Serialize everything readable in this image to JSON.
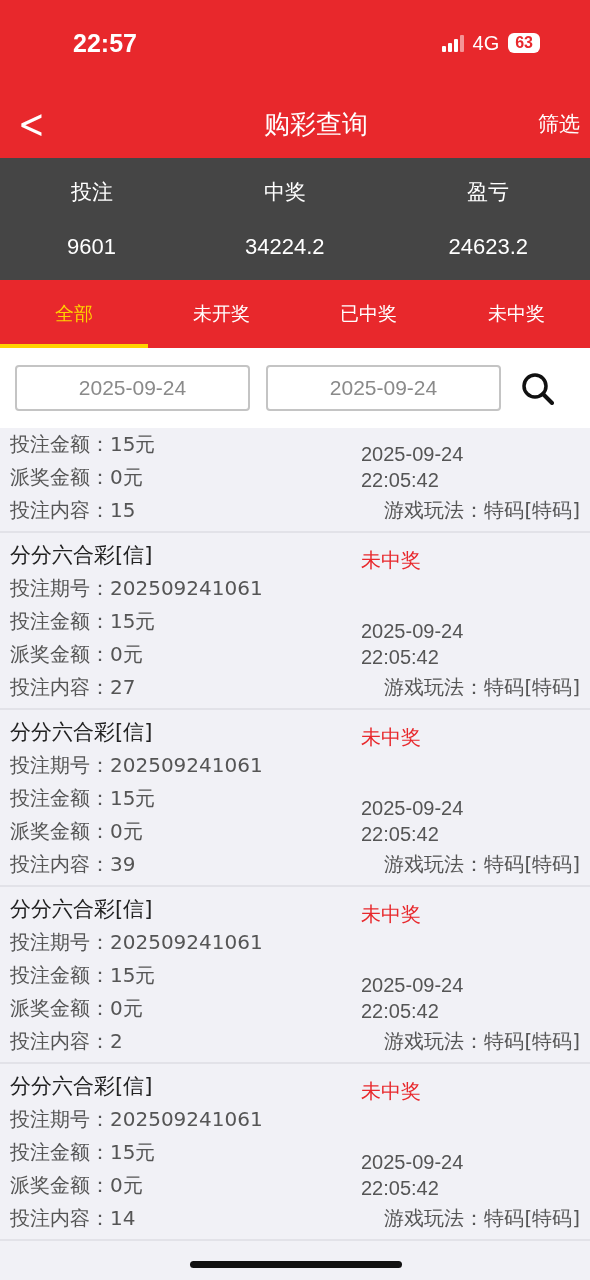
{
  "status_bar": {
    "time": "22:57",
    "network": "4G",
    "battery": "63"
  },
  "nav": {
    "back": "<",
    "title": "购彩查询",
    "action": "筛选"
  },
  "summary": [
    {
      "label": "投注",
      "value": "9601"
    },
    {
      "label": "中奖",
      "value": "34224.2"
    },
    {
      "label": "盈亏",
      "value": "24623.2"
    }
  ],
  "tabs": [
    {
      "label": "全部",
      "selected": true
    },
    {
      "label": "未开奖",
      "selected": false
    },
    {
      "label": "已中奖",
      "selected": false
    },
    {
      "label": "未中奖",
      "selected": false
    }
  ],
  "date_range": {
    "start": "2025-09-24",
    "end": "2025-09-24"
  },
  "records": [
    {
      "amount": "投注金额：15元",
      "payout": "派奖金额：0元",
      "content": "投注内容：15",
      "date": "2025-09-24",
      "time": "22:05:42",
      "play": "游戏玩法：特码[特码]"
    },
    {
      "name": "分分六合彩[信]",
      "status": "未中奖",
      "period": "投注期号：202509241061",
      "amount": "投注金额：15元",
      "payout": "派奖金额：0元",
      "content": "投注内容：27",
      "date": "2025-09-24",
      "time": "22:05:42",
      "play": "游戏玩法：特码[特码]"
    },
    {
      "name": "分分六合彩[信]",
      "status": "未中奖",
      "period": "投注期号：202509241061",
      "amount": "投注金额：15元",
      "payout": "派奖金额：0元",
      "content": "投注内容：39",
      "date": "2025-09-24",
      "time": "22:05:42",
      "play": "游戏玩法：特码[特码]"
    },
    {
      "name": "分分六合彩[信]",
      "status": "未中奖",
      "period": "投注期号：202509241061",
      "amount": "投注金额：15元",
      "payout": "派奖金额：0元",
      "content": "投注内容：2",
      "date": "2025-09-24",
      "time": "22:05:42",
      "play": "游戏玩法：特码[特码]"
    },
    {
      "name": "分分六合彩[信]",
      "status": "未中奖",
      "period": "投注期号：202509241061",
      "amount": "投注金额：15元",
      "payout": "派奖金额：0元",
      "content": "投注内容：14",
      "date": "2025-09-24",
      "time": "22:05:42",
      "play": "游戏玩法：特码[特码]"
    }
  ]
}
